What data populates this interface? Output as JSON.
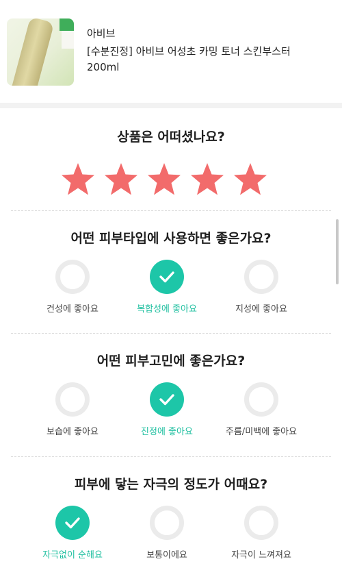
{
  "product": {
    "brand": "아비브",
    "name": "[수분진정] 아비브 어성초 카밍 토너 스킨부스터 200ml",
    "image_icon": "toner-bottle-image"
  },
  "rating": {
    "title": "상품은 어떠셨나요?",
    "stars_selected": 5,
    "stars_total": 5,
    "star_color": "#f26b6b"
  },
  "skin_type": {
    "title": "어떤 피부타입에 사용하면 좋은가요?",
    "options": [
      {
        "label": "건성에 좋아요",
        "selected": false
      },
      {
        "label": "복합성에 좋아요",
        "selected": true
      },
      {
        "label": "지성에 좋아요",
        "selected": false
      }
    ]
  },
  "skin_concern": {
    "title": "어떤 피부고민에 좋은가요?",
    "options": [
      {
        "label": "보습에 좋아요",
        "selected": false
      },
      {
        "label": "진정에 좋아요",
        "selected": true
      },
      {
        "label": "주름/미백에 좋아요",
        "selected": false
      }
    ]
  },
  "irritation": {
    "title": "피부에 닿는 자극의 정도가 어때요?",
    "options": [
      {
        "label": "자극없이 순해요",
        "selected": true
      },
      {
        "label": "보통이에요",
        "selected": false
      },
      {
        "label": "자극이 느껴져요",
        "selected": false
      }
    ]
  },
  "colors": {
    "accent": "#1dc6a8",
    "accent_text": "#1dbf9f",
    "unselected_ring": "#ebebeb"
  }
}
